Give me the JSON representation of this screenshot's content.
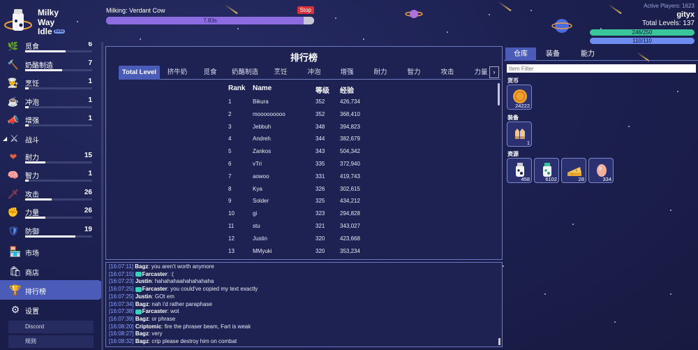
{
  "header": {
    "logo_lines": [
      "Milky",
      "Way",
      "Idle"
    ],
    "beta": "beta",
    "action_label": "Milking: Verdant Cow",
    "stop_label": "Stop",
    "progress_text": "7.83s",
    "progress_fraction": 0.95,
    "active_players": "Active Players: 1623",
    "username": "gityx",
    "total_levels": "Total Levels: 137",
    "hp_text": "246/250",
    "hp_fraction": 0.984,
    "mp_text": "110/110",
    "mp_fraction": 1.0
  },
  "sidebar": {
    "skills_top": [
      {
        "name": "觅食",
        "level": "6",
        "xp": 0.6,
        "icon": "forage-icon",
        "glyph": "🌿",
        "color": "#c66"
      },
      {
        "name": "奶酪制造",
        "level": "7",
        "xp": 0.55,
        "icon": "hammer-icon",
        "glyph": "🔨",
        "color": "#d9a23a"
      },
      {
        "name": "烹饪",
        "level": "1",
        "xp": 0.05,
        "icon": "chef-hat-icon",
        "glyph": "👨‍🍳",
        "color": "#eee"
      },
      {
        "name": "冲泡",
        "level": "1",
        "xp": 0.05,
        "icon": "teacup-icon",
        "glyph": "☕",
        "color": "#3ad0c0"
      },
      {
        "name": "增强",
        "level": "1",
        "xp": 0.05,
        "icon": "megaphone-icon",
        "glyph": "📣",
        "color": "#ddd"
      }
    ],
    "combat_section": "战斗",
    "skills_combat": [
      {
        "name": "耐力",
        "level": "15",
        "xp": 0.3,
        "icon": "heart-icon",
        "glyph": "❤",
        "color": "#e06040"
      },
      {
        "name": "智力",
        "level": "1",
        "xp": 0.05,
        "icon": "brain-icon",
        "glyph": "🧠",
        "color": "#f09090"
      },
      {
        "name": "攻击",
        "level": "26",
        "xp": 0.4,
        "icon": "sword-icon",
        "glyph": "🗡",
        "color": "#e05050"
      },
      {
        "name": "力量",
        "level": "26",
        "xp": 0.3,
        "icon": "fist-icon",
        "glyph": "✊",
        "color": "#f0a040"
      },
      {
        "name": "防御",
        "level": "19",
        "xp": 0.75,
        "icon": "shield-icon",
        "glyph": "🛡",
        "color": "#5a8cf0"
      }
    ],
    "nav": [
      {
        "name": "市场",
        "icon": "market-icon",
        "glyph": "🏪",
        "active": false
      },
      {
        "name": "商店",
        "icon": "shop-bag-icon",
        "glyph": "🛍",
        "active": false
      },
      {
        "name": "排行榜",
        "icon": "trophy-icon",
        "glyph": "🏆",
        "active": true
      },
      {
        "name": "设置",
        "icon": "gear-icon",
        "glyph": "⚙",
        "active": false
      }
    ],
    "links": [
      "Discord",
      "规则"
    ]
  },
  "leaderboard": {
    "title": "排行榜",
    "tabs": [
      "Total Level",
      "挤牛奶",
      "觅食",
      "奶酪制造",
      "烹饪",
      "冲泡",
      "增强",
      "耐力",
      "智力",
      "攻击",
      "力量"
    ],
    "active_tab": 0,
    "more_arrow": "›",
    "columns": [
      "Rank",
      "Name",
      "等级",
      "经验"
    ],
    "rows": [
      [
        "1",
        "Bikura",
        "352",
        "426,734"
      ],
      [
        "2",
        "mooooooooo",
        "352",
        "368,410"
      ],
      [
        "3",
        "Jebbuh",
        "348",
        "394,823"
      ],
      [
        "4",
        "Andreh",
        "344",
        "382,679"
      ],
      [
        "5",
        "Zankos",
        "343",
        "504,342"
      ],
      [
        "6",
        "vTri",
        "335",
        "372,940"
      ],
      [
        "7",
        "aowoo",
        "331",
        "419,743"
      ],
      [
        "8",
        "Kya",
        "326",
        "302,615"
      ],
      [
        "9",
        "Solder",
        "325",
        "434,212"
      ],
      [
        "10",
        "gi",
        "323",
        "294,828"
      ],
      [
        "11",
        "stu",
        "321",
        "343,027"
      ],
      [
        "12",
        "Justin",
        "320",
        "423,668"
      ],
      [
        "13",
        "MMyuki",
        "320",
        "353,234"
      ]
    ]
  },
  "chat": {
    "messages": [
      {
        "time": "[16:07:11]",
        "user": "Bagz",
        "badge": false,
        "text": " you aren't worth anymore"
      },
      {
        "time": "[16:07:15]",
        "user": "Farcaster",
        "badge": true,
        "text": " :("
      },
      {
        "time": "[16:07:23]",
        "user": "Justin",
        "badge": false,
        "text": " hahahahaahahahahaha"
      },
      {
        "time": "[16:07:25]",
        "user": "Farcaster",
        "badge": true,
        "text": " you could've copied my text exactly"
      },
      {
        "time": "[16:07:25]",
        "user": "Justin",
        "badge": false,
        "text": " GOt em"
      },
      {
        "time": "[16:07:34]",
        "user": "Bagz",
        "badge": false,
        "text": " nah i'd rather paraphase"
      },
      {
        "time": "[16:07:38]",
        "user": "Farcaster",
        "badge": true,
        "text": " wot"
      },
      {
        "time": "[16:07:39]",
        "user": "Bagz",
        "badge": false,
        "text": " or phrase"
      },
      {
        "time": "[16:08:20]",
        "user": "Criptomic",
        "badge": false,
        "text": " fire the phraser beam, Fart is weak"
      },
      {
        "time": "[16:08:27]",
        "user": "Bagz",
        "badge": false,
        "text": " very"
      },
      {
        "time": "[16:08:32]",
        "user": "Bagz",
        "badge": false,
        "text": " crip please destroy him on combat"
      }
    ]
  },
  "inventory": {
    "tabs": [
      "仓库",
      "装备",
      "能力"
    ],
    "active_tab": 0,
    "filter_placeholder": "Item Filter",
    "categories": {
      "currency": "货币",
      "equipment": "装备",
      "resources": "资源"
    },
    "currency_items": [
      {
        "name": "coin-icon",
        "qty": "24222"
      }
    ],
    "equipment_items": [
      {
        "name": "gloves-icon",
        "qty": "1"
      }
    ],
    "resource_items": [
      {
        "name": "milk-icon",
        "qty": "458"
      },
      {
        "name": "verdant-milk-icon",
        "qty": "6102"
      },
      {
        "name": "cheese-icon",
        "qty": "28"
      },
      {
        "name": "egg-icon",
        "qty": "334"
      }
    ]
  }
}
